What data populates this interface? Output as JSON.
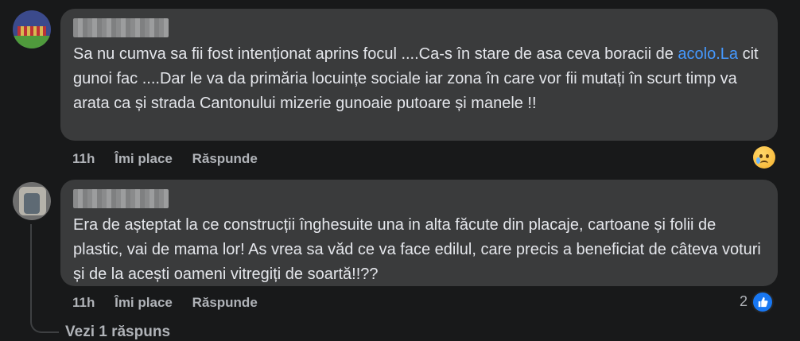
{
  "comments": [
    {
      "text_before_link": "Sa nu cumva sa fii fost intenționat aprins focul ....Ca-s în stare de asa ceva boracii de ",
      "link": "acolo.La",
      "text_after_link": " cit gunoi fac ....Dar le va da primăria locuințe sociale iar zona în care vor fii mutați în scurt timp va arata ca și strada Cantonului mizerie gunoaie putoare și manele !!",
      "time": "11h",
      "like": "Îmi place",
      "reply": "Răspunde",
      "reaction_icon": "crying-face-icon"
    },
    {
      "text": "Era de așteptat la ce construcții înghesuite una in alta făcute din placaje, cartoane și folii de plastic, vai de mama lor! As vrea sa văd ce va face edilul, care precis a beneficiat de câteva voturi și de la acești oameni vitregiți de soartă!!??",
      "time": "11h",
      "like": "Îmi place",
      "reply": "Răspunde",
      "reaction_count": "2",
      "reaction_icon": "like-icon"
    }
  ],
  "view_replies": "Vezi 1 răspuns",
  "colors": {
    "background": "#18191a",
    "bubble": "#3a3b3c",
    "link": "#4599ff",
    "meta": "#b0b3b8",
    "like": "#1877f2"
  }
}
